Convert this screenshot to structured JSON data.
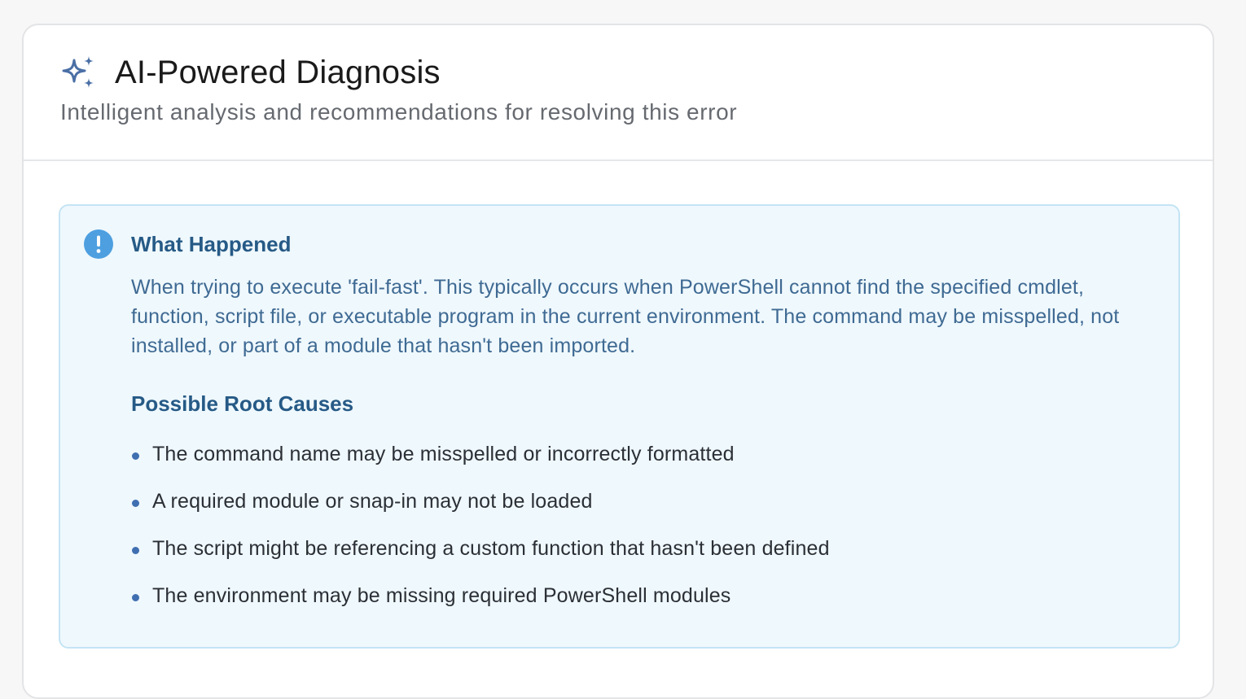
{
  "header": {
    "icon": "sparkles-icon",
    "title": "AI-Powered Diagnosis",
    "subtitle": "Intelligent analysis and recommendations for resolving this error"
  },
  "alert": {
    "icon": "info-circle-icon",
    "title": "What Happened",
    "body": "When trying to execute 'fail-fast'. This typically occurs when PowerShell cannot find the specified cmdlet, function, script file, or executable program in the current environment. The command may be misspelled, not installed, or part of a module that hasn't been imported.",
    "causes_title": "Possible Root Causes",
    "causes": [
      "The command name may be misspelled or incorrectly formatted",
      "A required module or snap-in may not be loaded",
      "The script might be referencing a custom function that hasn't been defined",
      "The environment may be missing required PowerShell modules"
    ]
  },
  "colors": {
    "accent": "#4a6fa5",
    "info_icon": "#4d9fe0",
    "alert_background": "#eff8fd",
    "alert_border": "#c4e4f4",
    "heading_text": "#265a86",
    "body_text": "#3f6a93"
  }
}
